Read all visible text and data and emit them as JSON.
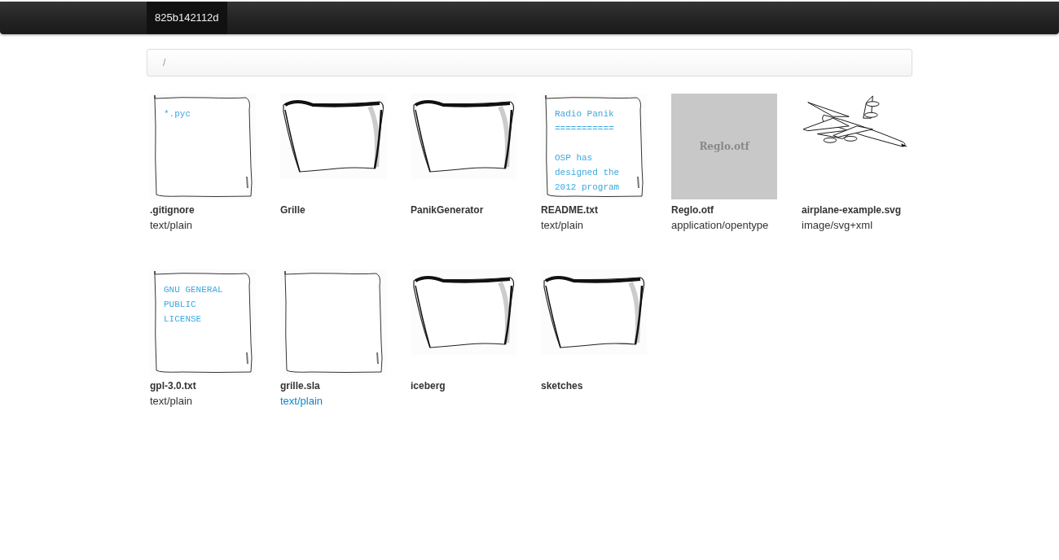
{
  "navbar": {
    "brand": "825b142112d"
  },
  "breadcrumb": {
    "path": "/"
  },
  "files": [
    {
      "kind": "text",
      "name": ".gitignore",
      "mime": "text/plain",
      "highlighted": false,
      "preview": [
        [
          "*.pyc"
        ]
      ]
    },
    {
      "kind": "folder",
      "name": "Grille"
    },
    {
      "kind": "folder",
      "name": "PanikGenerator"
    },
    {
      "kind": "text",
      "name": "README.txt",
      "mime": "text/plain",
      "highlighted": false,
      "preview": [
        [
          "Radio Panik",
          "==========="
        ],
        [
          "OSP has",
          "designed the",
          "2012 program"
        ]
      ]
    },
    {
      "kind": "font",
      "name": "Reglo.otf",
      "mime": "application/opentype",
      "highlighted": false,
      "sample": "Reglo.otf"
    },
    {
      "kind": "image",
      "name": "airplane-example.svg",
      "mime": "image/svg+xml",
      "highlighted": false
    },
    {
      "kind": "text",
      "name": "gpl-3.0.txt",
      "mime": "text/plain",
      "highlighted": false,
      "preview": [
        [
          "GNU GENERAL",
          "PUBLIC",
          "LICENSE"
        ]
      ]
    },
    {
      "kind": "text",
      "name": "grille.sla",
      "mime": "text/plain",
      "highlighted": true
    },
    {
      "kind": "folder",
      "name": "iceberg"
    },
    {
      "kind": "folder",
      "name": "sketches"
    }
  ]
}
